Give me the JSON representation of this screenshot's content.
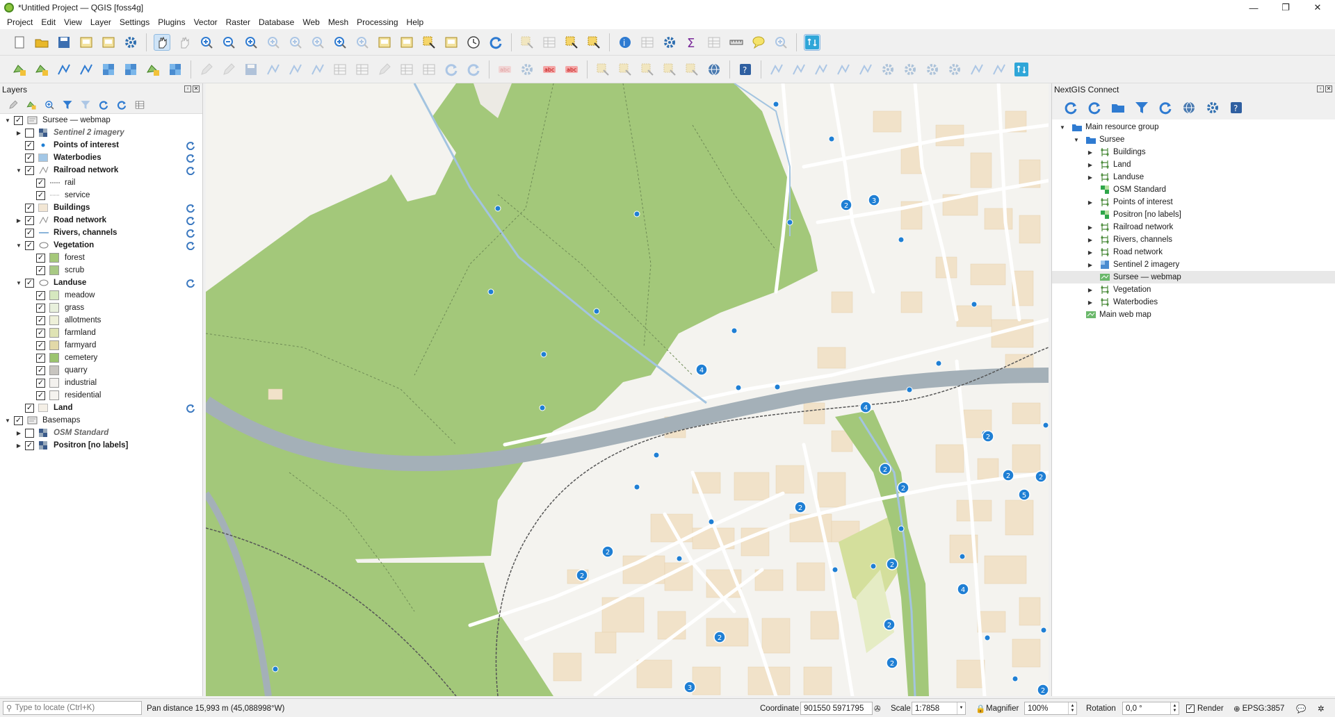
{
  "window": {
    "title": "*Untitled Project — QGIS [foss4g]",
    "minimize": "—",
    "maximize": "❐",
    "close": "✕"
  },
  "menu": [
    "Project",
    "Edit",
    "View",
    "Layer",
    "Settings",
    "Plugins",
    "Vector",
    "Raster",
    "Database",
    "Web",
    "Mesh",
    "Processing",
    "Help"
  ],
  "layers_panel": {
    "title": "Layers",
    "tree": [
      {
        "label": "Sursee — webmap",
        "level": 0,
        "expanded": true,
        "checked": true,
        "style": "normal",
        "symbol": "webmap"
      },
      {
        "label": "Sentinel 2 imagery",
        "level": 1,
        "expanded": false,
        "checked": false,
        "style": "italic",
        "symbol": "raster"
      },
      {
        "label": "Points of interest",
        "level": 1,
        "checked": true,
        "style": "bold",
        "symbol": "point",
        "sync": true
      },
      {
        "label": "Waterbodies",
        "level": 1,
        "checked": true,
        "style": "bold",
        "symbol": "water",
        "sync": true
      },
      {
        "label": "Railroad network",
        "level": 1,
        "expanded": true,
        "checked": true,
        "style": "bold",
        "symbol": "line",
        "sync": true
      },
      {
        "label": "rail",
        "level": 2,
        "checked": true,
        "style": "normal",
        "symbol": "rail"
      },
      {
        "label": "service",
        "level": 2,
        "checked": true,
        "style": "normal",
        "symbol": "service"
      },
      {
        "label": "Buildings",
        "level": 1,
        "checked": true,
        "style": "bold",
        "symbol": "buildings",
        "sync": true
      },
      {
        "label": "Road network",
        "level": 1,
        "expanded": false,
        "checked": true,
        "style": "bold",
        "symbol": "line",
        "sync": true
      },
      {
        "label": "Rivers, channels",
        "level": 1,
        "checked": true,
        "style": "bold",
        "symbol": "river",
        "sync": true
      },
      {
        "label": "Vegetation",
        "level": 1,
        "expanded": true,
        "checked": true,
        "style": "bold",
        "symbol": "polygon",
        "sync": true
      },
      {
        "label": "forest",
        "level": 2,
        "checked": true,
        "style": "normal",
        "symbol": "forest"
      },
      {
        "label": "scrub",
        "level": 2,
        "checked": true,
        "style": "normal",
        "symbol": "scrub"
      },
      {
        "label": "Landuse",
        "level": 1,
        "expanded": true,
        "checked": true,
        "style": "bold",
        "symbol": "polygon",
        "sync": true
      },
      {
        "label": "meadow",
        "level": 2,
        "checked": true,
        "style": "normal",
        "symbol": "meadow"
      },
      {
        "label": "grass",
        "level": 2,
        "checked": true,
        "style": "normal",
        "symbol": "grass"
      },
      {
        "label": "allotments",
        "level": 2,
        "checked": true,
        "style": "normal",
        "symbol": "allotments"
      },
      {
        "label": "farmland",
        "level": 2,
        "checked": true,
        "style": "normal",
        "symbol": "farmland"
      },
      {
        "label": "farmyard",
        "level": 2,
        "checked": true,
        "style": "normal",
        "symbol": "farmyard"
      },
      {
        "label": "cemetery",
        "level": 2,
        "checked": true,
        "style": "normal",
        "symbol": "cemetery"
      },
      {
        "label": "quarry",
        "level": 2,
        "checked": true,
        "style": "normal",
        "symbol": "quarry"
      },
      {
        "label": "industrial",
        "level": 2,
        "checked": true,
        "style": "normal",
        "symbol": "industrial"
      },
      {
        "label": "residential",
        "level": 2,
        "checked": true,
        "style": "normal",
        "symbol": "residential"
      },
      {
        "label": "Land",
        "level": 1,
        "checked": true,
        "style": "bold",
        "symbol": "land",
        "sync": true
      },
      {
        "label": "Basemaps",
        "level": 0,
        "expanded": true,
        "checked": true,
        "style": "normal",
        "symbol": "group"
      },
      {
        "label": "OSM Standard",
        "level": 1,
        "expanded": false,
        "checked": false,
        "style": "italic",
        "symbol": "raster"
      },
      {
        "label": "Positron [no labels]",
        "level": 1,
        "expanded": false,
        "checked": true,
        "style": "bold",
        "symbol": "raster"
      }
    ],
    "symbol_colors": {
      "water": "#a3c7e6",
      "buildings": "#f2e6d4",
      "forest": "#a5c87a",
      "scrub": "#a8c984",
      "meadow": "#d6e8bf",
      "grass": "#e8f0dc",
      "allotments": "#eef0d9",
      "farmland": "#dfe3b4",
      "farmyard": "#e2d9a8",
      "cemetery": "#9bc46f",
      "quarry": "#c8c5c0",
      "industrial": "#f3f1ee",
      "residential": "#f5f3ef",
      "land": "#f4efe6",
      "point": "#1f7fd4"
    }
  },
  "ngw_panel": {
    "title": "NextGIS Connect",
    "tree": [
      {
        "label": "Main resource group",
        "level": 0,
        "expanded": true,
        "icon": "folder"
      },
      {
        "label": "Sursee",
        "level": 1,
        "expanded": true,
        "icon": "folder"
      },
      {
        "label": "Buildings",
        "level": 2,
        "expanded": false,
        "icon": "vector"
      },
      {
        "label": "Land",
        "level": 2,
        "expanded": false,
        "icon": "vector"
      },
      {
        "label": "Landuse",
        "level": 2,
        "expanded": false,
        "icon": "vector"
      },
      {
        "label": "OSM Standard",
        "level": 2,
        "icon": "basemap"
      },
      {
        "label": "Points of interest",
        "level": 2,
        "expanded": false,
        "icon": "vector"
      },
      {
        "label": "Positron [no labels]",
        "level": 2,
        "icon": "basemap"
      },
      {
        "label": "Railroad network",
        "level": 2,
        "expanded": false,
        "icon": "vector"
      },
      {
        "label": "Rivers, channels",
        "level": 2,
        "expanded": false,
        "icon": "vector"
      },
      {
        "label": "Road network",
        "level": 2,
        "expanded": false,
        "icon": "vector"
      },
      {
        "label": "Sentinel 2 imagery",
        "level": 2,
        "expanded": false,
        "icon": "raster"
      },
      {
        "label": "Sursee — webmap",
        "level": 2,
        "icon": "webmap",
        "selected": true
      },
      {
        "label": "Vegetation",
        "level": 2,
        "expanded": false,
        "icon": "vector"
      },
      {
        "label": "Waterbodies",
        "level": 2,
        "expanded": false,
        "icon": "vector"
      },
      {
        "label": "Main web map",
        "level": 1,
        "icon": "webmap"
      }
    ]
  },
  "map": {
    "colors": {
      "forest": "#a3c87a",
      "land": "#f4f3ef",
      "road": "#ffffff",
      "highway": "#a4b0b8",
      "water": "#a3c4e0",
      "building": "#f1e2c9",
      "poi": "#1f7fd4",
      "meadow": "#dbe6b5"
    },
    "clusters": [
      {
        "value": "2"
      },
      {
        "value": "3"
      },
      {
        "value": "4"
      },
      {
        "value": "4"
      },
      {
        "value": "2"
      },
      {
        "value": "2"
      },
      {
        "value": "2"
      },
      {
        "value": "2"
      },
      {
        "value": "5"
      },
      {
        "value": "2"
      },
      {
        "value": "2"
      },
      {
        "value": "2"
      },
      {
        "value": "2"
      },
      {
        "value": "2"
      },
      {
        "value": "4"
      },
      {
        "value": "2"
      },
      {
        "value": "2"
      },
      {
        "value": "3"
      },
      {
        "value": "2"
      },
      {
        "value": "2"
      }
    ]
  },
  "statusbar": {
    "locate_placeholder": "Type to locate (Ctrl+K)",
    "message": "Pan distance 15,993 m (45,088998°W)",
    "coordinate_label": "Coordinate",
    "coordinate_value": "901550  5971795",
    "scale_label": "Scale",
    "scale_value": "1:7858",
    "magnifier_label": "Magnifier",
    "magnifier_value": "100%",
    "rotation_label": "Rotation",
    "rotation_value": "0,0 °",
    "render_label": "Render",
    "render_checked": true,
    "crs": "EPSG:3857"
  }
}
